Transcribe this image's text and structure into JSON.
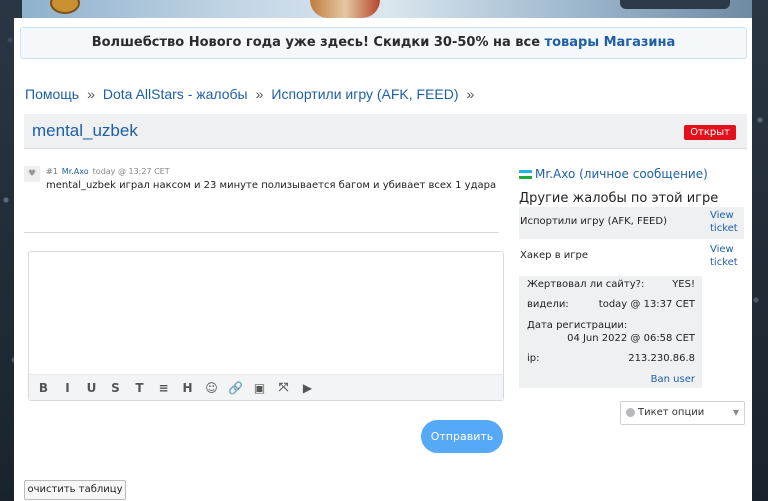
{
  "promo": {
    "text": "Волшебство Нового года уже здесь! Скидки 30-50% на все ",
    "link": "товары Магазина"
  },
  "breadcrumb": [
    "Помощь",
    "Dota AllStars - жалобы",
    "Испортили игру (AFK, FEED)"
  ],
  "breadcrumb_sep": "»",
  "ticket": {
    "title": "mental_uzbek",
    "status": "Открыт"
  },
  "post": {
    "number": "#1",
    "author": "Mr.Axo",
    "time": "today @ 13:27 CET",
    "text": "mental_uzbek играл наксом и 23 минуте полизывается багом и убивает всех 1 удара"
  },
  "editor": {
    "toolbar": [
      "B",
      "I",
      "U",
      "S",
      "T",
      "≡",
      "H",
      "☺",
      "🔗",
      "▣",
      "⤧",
      "▶"
    ],
    "toolbar_names": [
      "bold-icon",
      "italic-icon",
      "underline-icon",
      "strikethrough-icon",
      "clear-format-icon",
      "list-icon",
      "heading-icon",
      "emoji-icon",
      "link-icon",
      "image-icon",
      "spoiler-icon",
      "video-icon"
    ],
    "submit": "Отправить"
  },
  "clear_button": "очистить таблицу",
  "sidebar": {
    "user_link": "Mr.Axo (личное сообщение)",
    "heading": "Другие жалобы по этой игре",
    "complaints": [
      {
        "label": "Испортили игру (AFK, FEED)",
        "link": "View ticket"
      },
      {
        "label": "Хакер в игре",
        "link": "View ticket"
      }
    ],
    "info": {
      "donated_label": "Жертвовал ли сайту?:",
      "donated_value": "YES!",
      "seen_label": "видели:",
      "seen_value": "today @ 13:37 CET",
      "reg_label": "Дата регистрации:",
      "reg_value": "04 Jun 2022 @ 06:58 CET",
      "ip_label": "ip:",
      "ip_value": "213.230.86.8",
      "ban": "Ban user"
    },
    "options": "Тикет опции"
  }
}
